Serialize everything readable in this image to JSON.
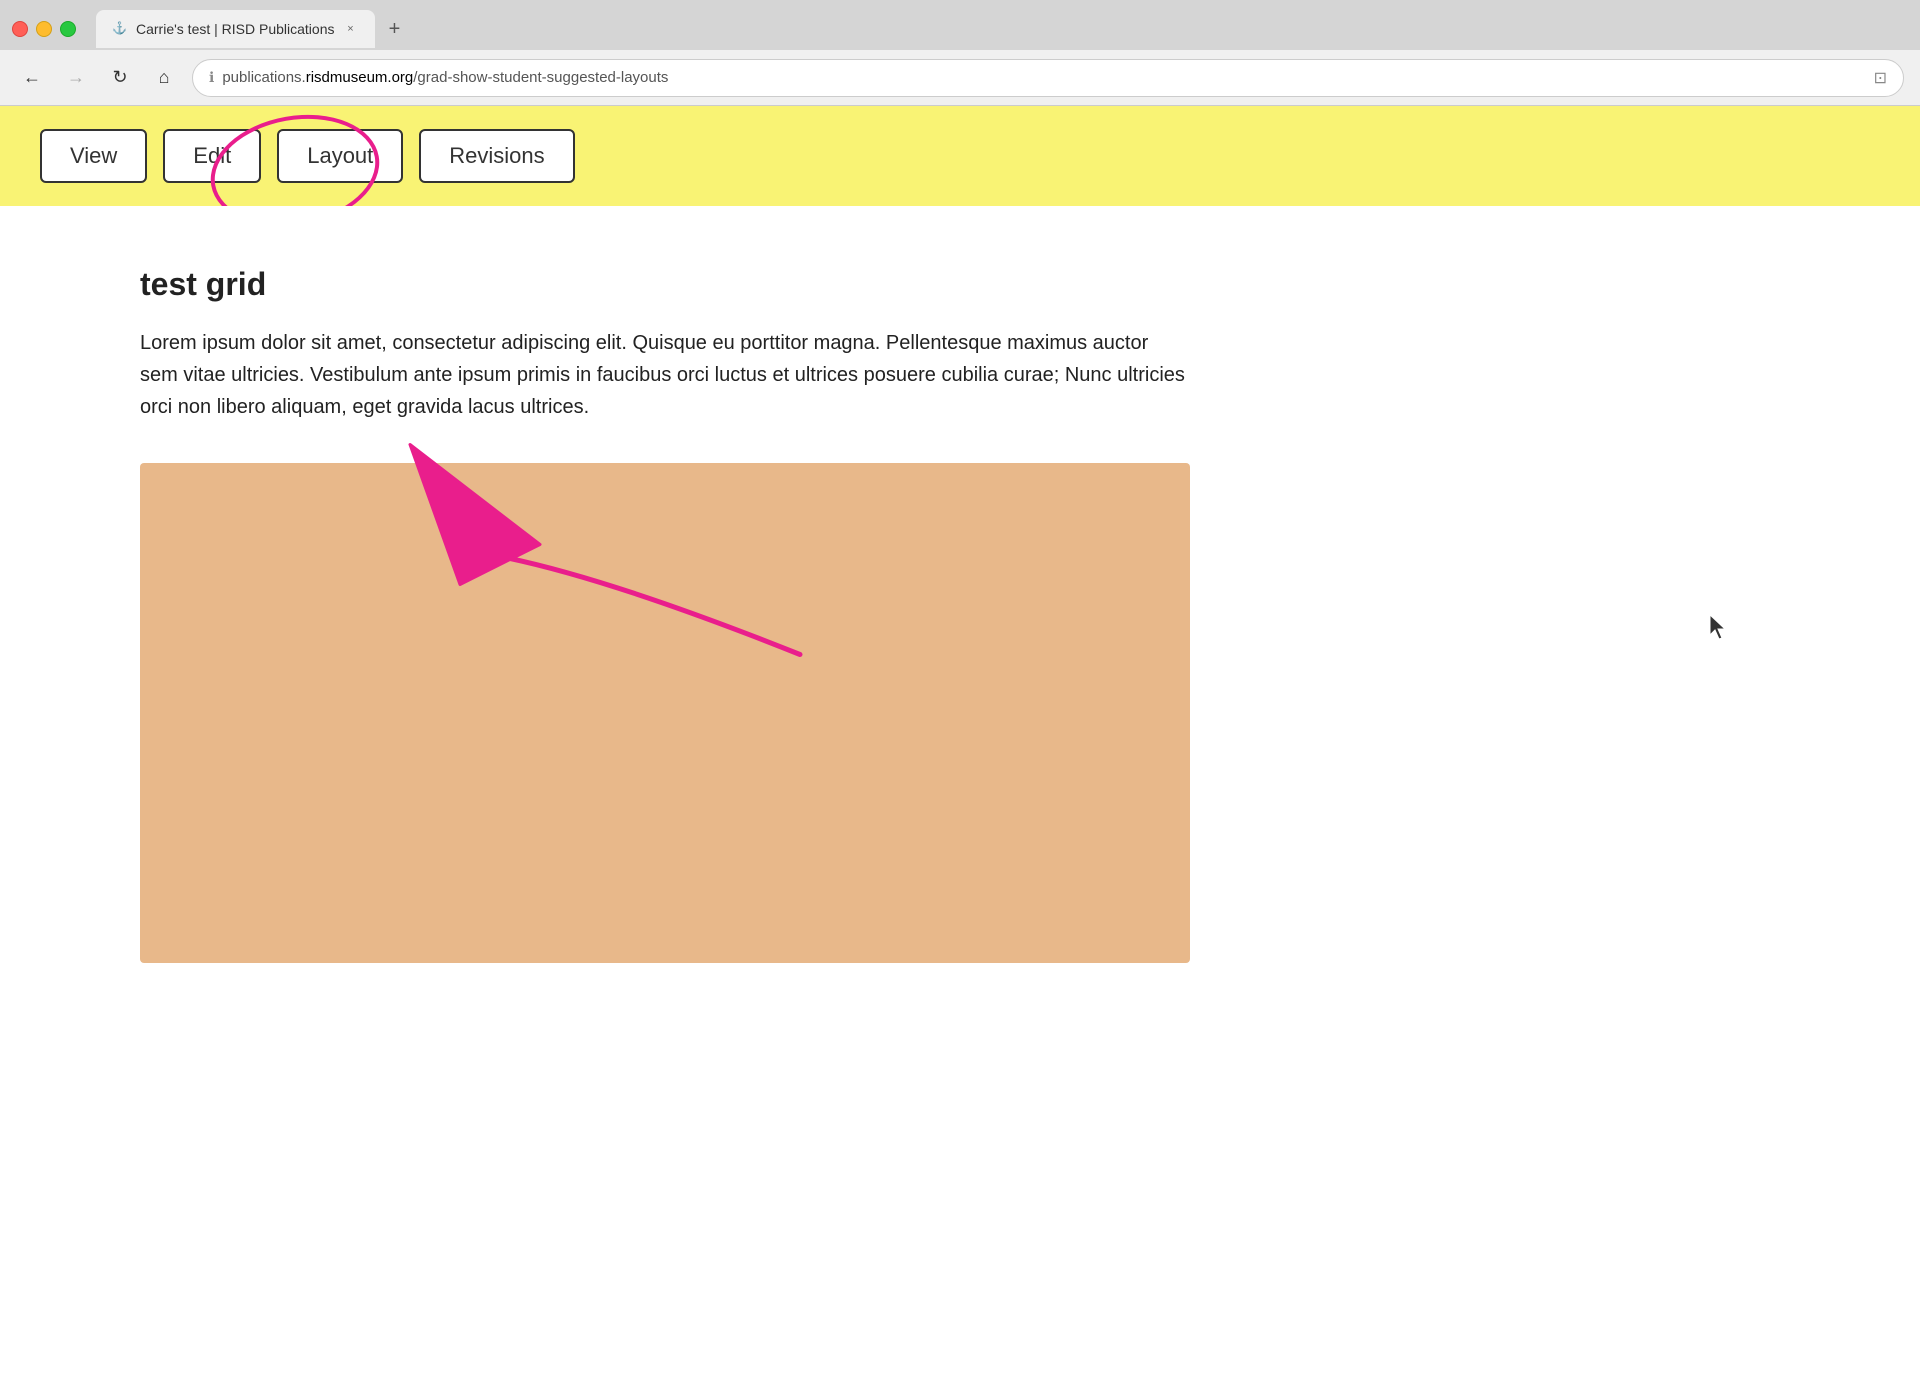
{
  "browser": {
    "traffic_lights": [
      "close",
      "minimize",
      "maximize"
    ],
    "tab_label": "Carrie's test | RISD Publications",
    "tab_close": "×",
    "new_tab": "+",
    "nav": {
      "back": "←",
      "forward": "→",
      "reload": "↻",
      "home": "⌂"
    },
    "address": {
      "protocol": "publications.",
      "domain": "risdmuseum.org",
      "path": "/grad-show-student-suggested-layouts"
    },
    "reader_icon": "⊡"
  },
  "cms_toolbar": {
    "buttons": [
      "View",
      "Edit",
      "Layout",
      "Revisions"
    ]
  },
  "page": {
    "title": "test grid",
    "body": "Lorem ipsum dolor sit amet, consectetur adipiscing elit. Quisque eu porttitor magna. Pellentesque maximus auctor sem vitae ultricies. Vestibulum ante ipsum primis in faucibus orci luctus et ultrices posuere cubilia curae; Nunc ultricies orci non libero aliquam, eget gravida lacus ultrices.",
    "image_placeholder_color": "#e8b88a"
  },
  "annotations": {
    "circle_color": "#e91e8c",
    "arrow_color": "#e91e8c"
  }
}
